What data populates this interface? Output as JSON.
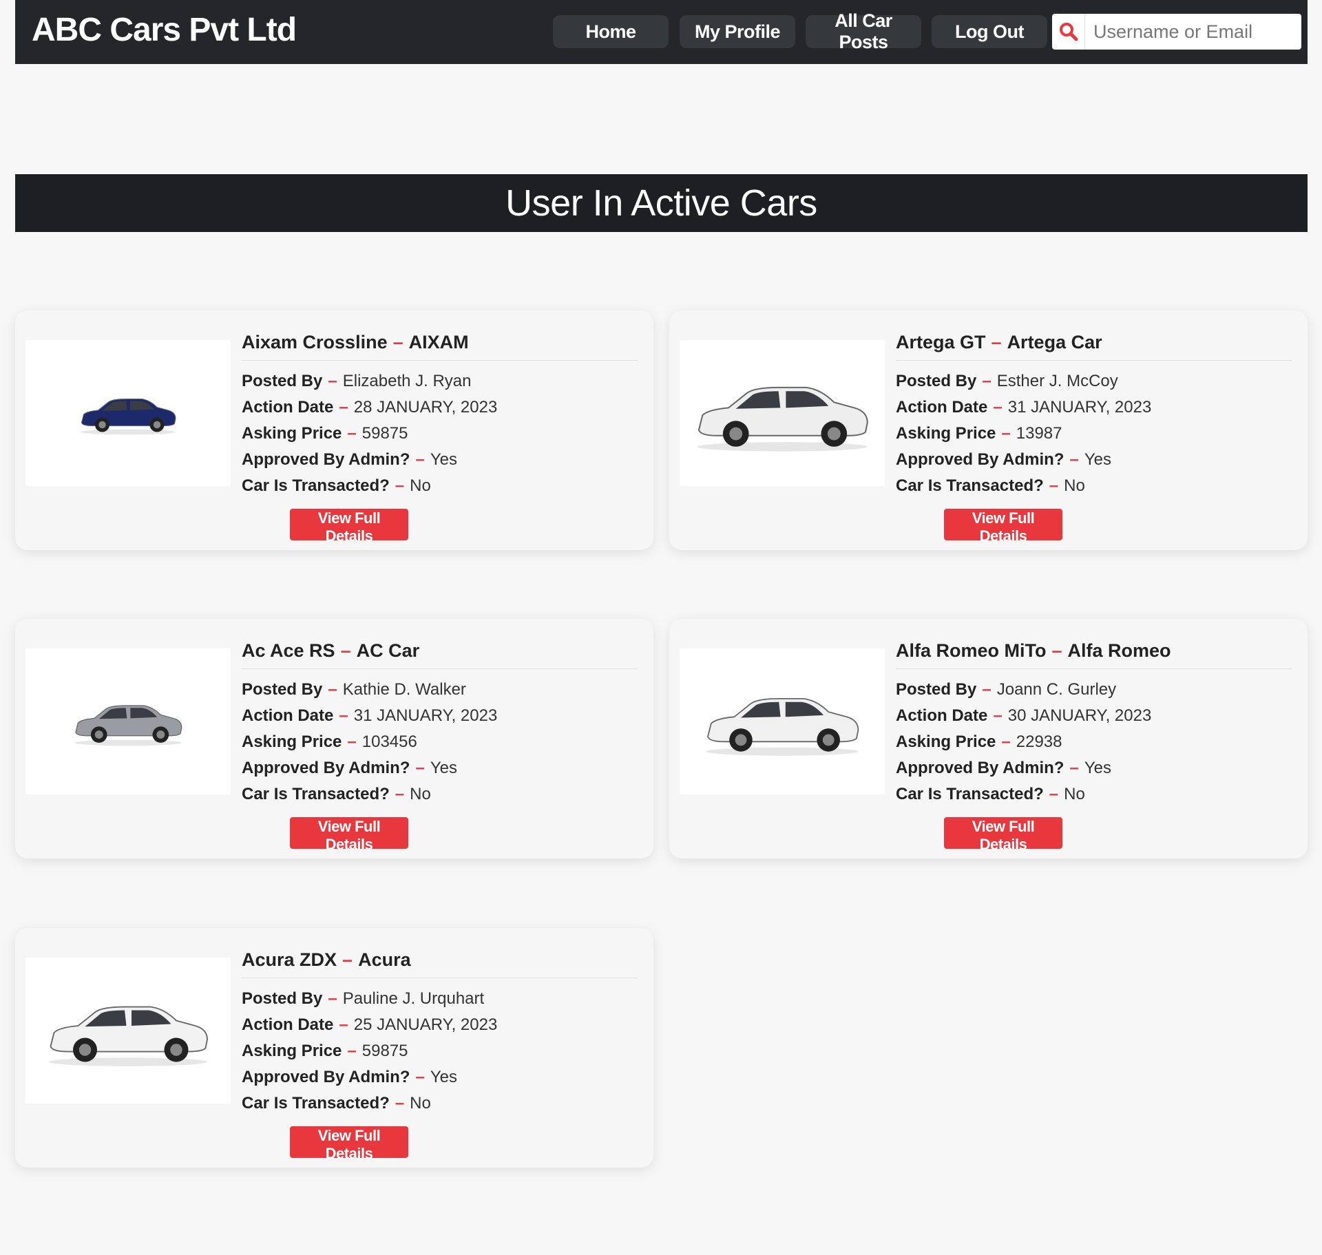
{
  "brand": "ABC Cars Pvt Ltd",
  "nav": {
    "home": "Home",
    "profile": "My Profile",
    "all_posts": "All Car Posts",
    "logout": "Log Out"
  },
  "search": {
    "placeholder": "Username or Email",
    "icon": "search-icon"
  },
  "section_title": "User In Active Cars",
  "labels": {
    "posted_by": "Posted By",
    "action_date": "Action Date",
    "asking_price": "Asking Price",
    "approved": "Approved By Admin?",
    "transacted": "Car Is Transacted?",
    "view_button": "View Full Details",
    "separator": "–"
  },
  "colors": {
    "accent": "#e8383d",
    "navbar": "#24262a",
    "banner": "#1e1f22",
    "nav_button": "#35383d",
    "background": "#f7f7f7"
  },
  "cars": [
    {
      "model": "Aixam Crossline",
      "make": "AIXAM",
      "posted_by": "Elizabeth J. Ryan",
      "action_date": "28 JANUARY, 2023",
      "asking_price": "59875",
      "approved": "Yes",
      "transacted": "No",
      "image": "dark-blue-suv",
      "image_color": "#1c2a6b"
    },
    {
      "model": "Artega GT",
      "make": "Artega Car",
      "posted_by": "Esther J. McCoy",
      "action_date": "31 JANUARY, 2023",
      "asking_price": "13987",
      "approved": "Yes",
      "transacted": "No",
      "image": "white-sports-coupe",
      "image_color": "#eeeeee"
    },
    {
      "model": "Ac Ace RS",
      "make": "AC Car",
      "posted_by": "Kathie D. Walker",
      "action_date": "31 JANUARY, 2023",
      "asking_price": "103456",
      "approved": "Yes",
      "transacted": "No",
      "image": "silver-sedan",
      "image_color": "#9a9ca3"
    },
    {
      "model": "Alfa Romeo MiTo",
      "make": "Alfa Romeo",
      "posted_by": "Joann C. Gurley",
      "action_date": "30 JANUARY, 2023",
      "asking_price": "22938",
      "approved": "Yes",
      "transacted": "No",
      "image": "white-sedan",
      "image_color": "#f0f0f0"
    },
    {
      "model": "Acura ZDX",
      "make": "Acura",
      "posted_by": "Pauline J. Urquhart",
      "action_date": "25 JANUARY, 2023",
      "asking_price": "59875",
      "approved": "Yes",
      "transacted": "No",
      "image": "white-crossover",
      "image_color": "#f2f2f2"
    }
  ]
}
